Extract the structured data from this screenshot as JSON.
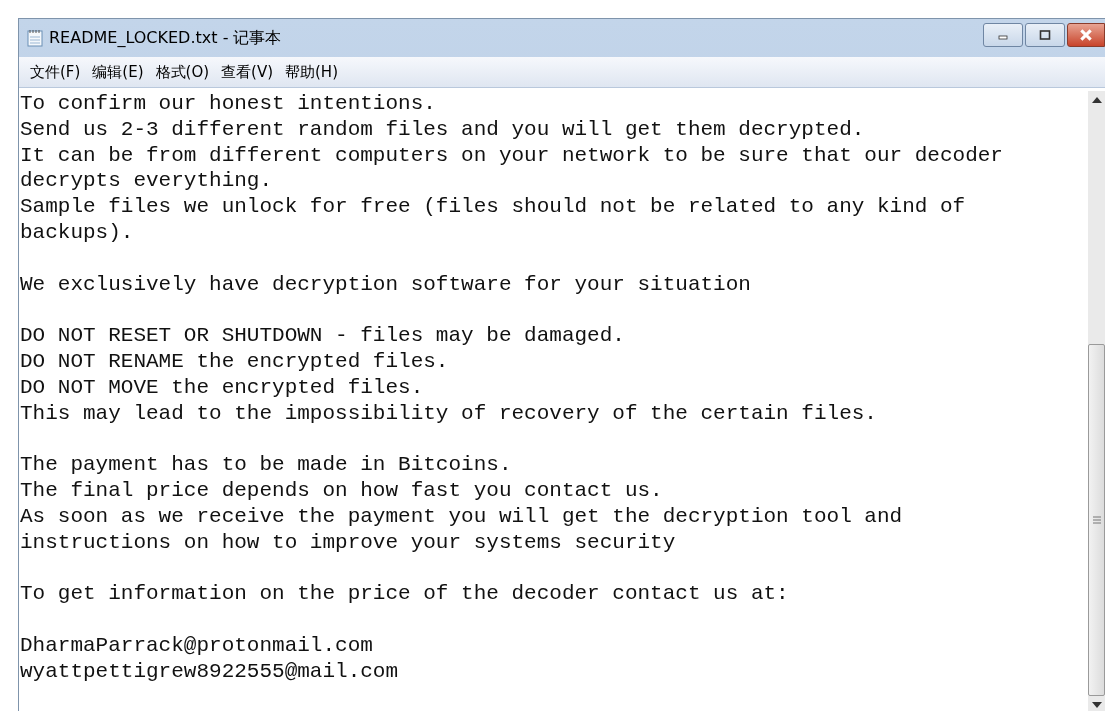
{
  "window": {
    "title": "README_LOCKED.txt - 记事本"
  },
  "menu": [
    {
      "label": "文件(F)"
    },
    {
      "label": "编辑(E)"
    },
    {
      "label": "格式(O)"
    },
    {
      "label": "查看(V)"
    },
    {
      "label": "帮助(H)"
    }
  ],
  "document": {
    "paragraphs": [
      [
        "To confirm our honest intentions.",
        "Send us 2-3 different random files and you will get them decrypted.",
        "It can be from different computers on your network to be sure that our decoder",
        "decrypts everything.",
        "Sample files we unlock for free (files should not be related to any kind of",
        "backups)."
      ],
      [
        "We exclusively have decryption software for your situation"
      ],
      [
        "DO NOT RESET OR SHUTDOWN - files may be damaged.",
        "DO NOT RENAME the encrypted files.",
        "DO NOT MOVE the encrypted files.",
        "This may lead to the impossibility of recovery of the certain files."
      ],
      [
        "The payment has to be made in Bitcoins.",
        "The final price depends on how fast you contact us.",
        "As soon as we receive the payment you will get the decryption tool and",
        "instructions on how to improve your systems security"
      ],
      [
        "To get information on the price of the decoder contact us at:"
      ],
      [
        "DharmaParrack@protonmail.com",
        "wyattpettigrew8922555@mail.com"
      ]
    ]
  }
}
